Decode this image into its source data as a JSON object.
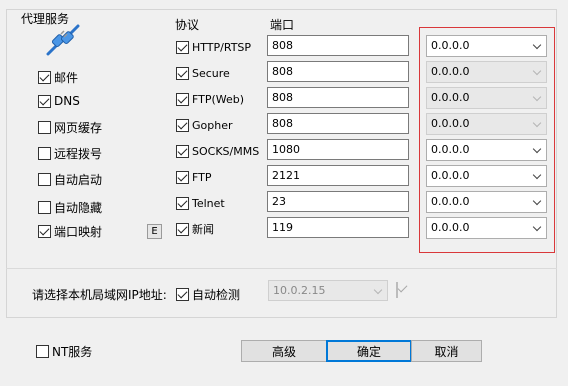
{
  "group_title": "代理服务",
  "headers": {
    "protocol": "协议",
    "port": "端口"
  },
  "left_options": [
    {
      "label": "邮件",
      "checked": true
    },
    {
      "label": "DNS",
      "checked": true
    },
    {
      "label": "网页缓存",
      "checked": false
    },
    {
      "label": "远程拨号",
      "checked": false
    },
    {
      "label": "自动启动",
      "checked": false
    },
    {
      "label": "自动隐藏",
      "checked": false
    },
    {
      "label": "端口映射",
      "checked": true
    }
  ],
  "port_mapping_button": "E",
  "services": [
    {
      "protocol": "HTTP/RTSP",
      "checked": true,
      "port": "808",
      "ip": "0.0.0.0",
      "ip_enabled": true
    },
    {
      "protocol": "Secure",
      "checked": true,
      "port": "808",
      "ip": "0.0.0.0",
      "ip_enabled": false
    },
    {
      "protocol": "FTP(Web)",
      "checked": true,
      "port": "808",
      "ip": "0.0.0.0",
      "ip_enabled": false
    },
    {
      "protocol": "Gopher",
      "checked": true,
      "port": "808",
      "ip": "0.0.0.0",
      "ip_enabled": false
    },
    {
      "protocol": "SOCKS/MMS",
      "checked": true,
      "port": "1080",
      "ip": "0.0.0.0",
      "ip_enabled": true
    },
    {
      "protocol": "FTP",
      "checked": true,
      "port": "2121",
      "ip": "0.0.0.0",
      "ip_enabled": true
    },
    {
      "protocol": "Telnet",
      "checked": true,
      "port": "23",
      "ip": "0.0.0.0",
      "ip_enabled": true
    },
    {
      "protocol": "新闻",
      "checked": true,
      "port": "119",
      "ip": "0.0.0.0",
      "ip_enabled": true
    }
  ],
  "lan_ip": {
    "label": "请选择本机局域网IP地址:",
    "auto_detect_label": "自动检测",
    "auto_detect_checked": true,
    "selected_ip": "10.0.2.15",
    "confirm_checked": true
  },
  "nt_service": {
    "label": "NT服务",
    "checked": false
  },
  "buttons": {
    "advanced": "高级",
    "ok": "确定",
    "cancel": "取消"
  },
  "colors": {
    "highlight_border": "#d9383a",
    "default_button_border": "#0078d7"
  }
}
